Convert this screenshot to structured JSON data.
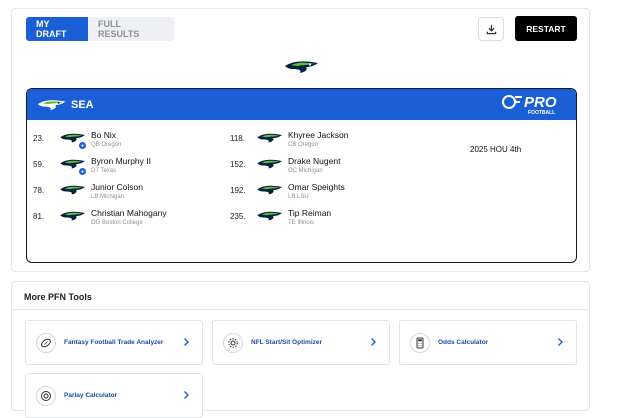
{
  "tabs": [
    {
      "label": "MY DRAFT",
      "active": true
    },
    {
      "label": "FULL RESULTS",
      "active": false
    }
  ],
  "actions": {
    "download_icon": "download-icon",
    "restart_label": "RESTART"
  },
  "team": {
    "abbr": "SEA",
    "logo_icon": "seahawks-logo-icon",
    "header_color": "#1b5fd6"
  },
  "brand": {
    "logo_text": "PRO",
    "logo_subtext": "FOOTBALL",
    "logo_icon": "pfn-logo-icon"
  },
  "picks": [
    {
      "num": "23.",
      "name": "Bo Nix",
      "meta": "QB Oregon",
      "badge": true
    },
    {
      "num": "59.",
      "name": "Byron Murphy II",
      "meta": "DT Texas",
      "badge": true
    },
    {
      "num": "78.",
      "name": "Junior Colson",
      "meta": "LB Michigan",
      "badge": false
    },
    {
      "num": "81.",
      "name": "Christian Mahogany",
      "meta": "OG Boston College",
      "badge": false
    },
    {
      "num": "118.",
      "name": "Khyree Jackson",
      "meta": "CB Oregon",
      "badge": false
    },
    {
      "num": "152.",
      "name": "Drake Nugent",
      "meta": "OC Michigan",
      "badge": false
    },
    {
      "num": "192.",
      "name": "Omar Speights",
      "meta": "LB LSU",
      "badge": false
    },
    {
      "num": "235.",
      "name": "Tip Reiman",
      "meta": "TE Illinois",
      "badge": false
    }
  ],
  "future_pick": "2025 HOU 4th",
  "tools": {
    "title": "More PFN Tools",
    "items": [
      {
        "label": "Fantasy Football Trade Analyzer",
        "icon": "football-icon"
      },
      {
        "label": "NFL Start/Sit Optimizer",
        "icon": "gear-icon"
      },
      {
        "label": "Odds Calculator",
        "icon": "calculator-icon"
      },
      {
        "label": "Parlay Calculator",
        "icon": "parlay-icon"
      }
    ]
  },
  "colors": {
    "accent": "#1b5fd6",
    "link": "#1b4aa8",
    "navy": "#002244",
    "green": "#69be28"
  }
}
